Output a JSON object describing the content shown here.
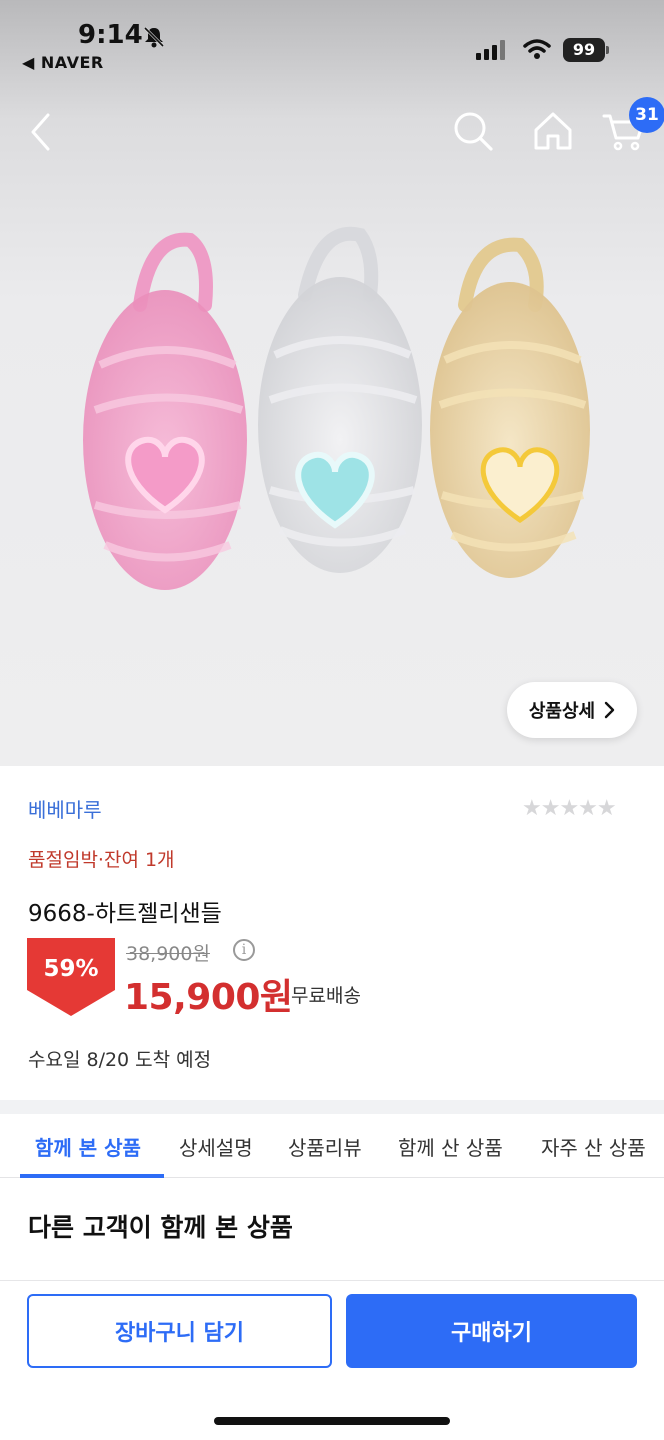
{
  "status": {
    "time": "9:14",
    "back_app": "◀ NAVER",
    "battery": "99"
  },
  "nav": {
    "cart_count": "31"
  },
  "hero": {
    "detail_button": "상품상세"
  },
  "product": {
    "brand": "베베마루",
    "rating_stars": "★★★★★",
    "stock_notice": "품절임박·잔여 1개",
    "name": "9668-하트젤리샌들",
    "discount": "59%",
    "original_price": "38,900원",
    "price": "15,900원",
    "shipping": "무료배송",
    "arrival": "수요일 8/20 도착 예정"
  },
  "tabs": [
    {
      "label": "함께 본 상품"
    },
    {
      "label": "상세설명"
    },
    {
      "label": "상품리뷰"
    },
    {
      "label": "함께 산 상품"
    },
    {
      "label": "자주 산 상품"
    }
  ],
  "section": {
    "title": "다른 고객이 함께 본 상품"
  },
  "actions": {
    "add_to_cart": "장바구니 담기",
    "buy": "구매하기"
  },
  "colors": {
    "accent": "#2d6cf6",
    "price_red": "#d32f2f",
    "brand_blue": "#3a6fd8"
  }
}
